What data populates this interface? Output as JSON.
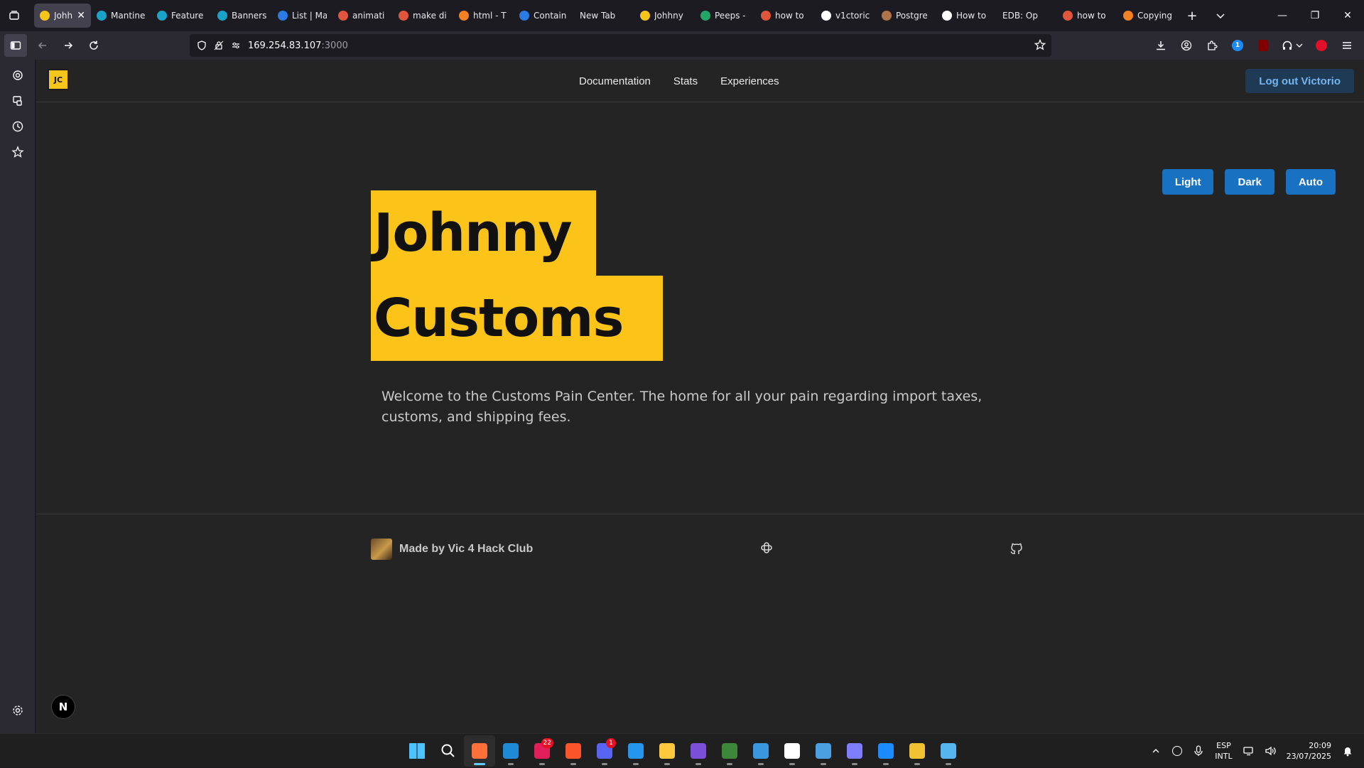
{
  "browser": {
    "tabs": [
      {
        "label": "Johh",
        "color": "#f6c51a",
        "active": true
      },
      {
        "label": "Mantine",
        "color": "#1aa3c9"
      },
      {
        "label": "Feature",
        "color": "#1aa3c9"
      },
      {
        "label": "Banners",
        "color": "#1aa3c9"
      },
      {
        "label": "List | Ma",
        "color": "#2a7be4"
      },
      {
        "label": "animati",
        "color": "#e0563c"
      },
      {
        "label": "make di",
        "color": "#e0563c"
      },
      {
        "label": "html - T",
        "color": "#f48024"
      },
      {
        "label": "Contain",
        "color": "#2a7be4"
      },
      {
        "label": "New Tab",
        "color": ""
      },
      {
        "label": "Johhny",
        "color": "#f6c51a"
      },
      {
        "label": "Peeps -",
        "color": "#23a566"
      },
      {
        "label": "how to",
        "color": "#e0563c"
      },
      {
        "label": "v1ctoric",
        "color": "#ffffff"
      },
      {
        "label": "Postgre",
        "color": "#b0744a"
      },
      {
        "label": "How to",
        "color": "#ffffff"
      },
      {
        "label": "EDB: Op",
        "color": ""
      },
      {
        "label": "how to",
        "color": "#e0563c"
      },
      {
        "label": "Copying",
        "color": "#f48024"
      }
    ],
    "url_host": "169.254.83.107",
    "url_port": ":3000"
  },
  "site": {
    "nav": [
      "Documentation",
      "Stats",
      "Experiences"
    ],
    "logout_label": "Log out Victorio",
    "theme_buttons": [
      "Light",
      "Dark",
      "Auto"
    ],
    "hero_line1": "Johnny",
    "hero_line2": "Customs",
    "welcome": "Welcome to the Customs Pain Center. The home for all your pain regarding import taxes, customs, and shipping fees.",
    "footer_credit": "Made by Vic 4 Hack Club",
    "next_badge": "N",
    "logo_text": "JC"
  },
  "taskbar": {
    "apps": [
      {
        "name": "windows-start",
        "color": "#4cc2ff"
      },
      {
        "name": "search",
        "color": ""
      },
      {
        "name": "firefox",
        "color": "#ff7139",
        "active": true
      },
      {
        "name": "vscode",
        "color": "#1e8ad6"
      },
      {
        "name": "slack",
        "color": "#e01e5a",
        "badge": "22"
      },
      {
        "name": "brave",
        "color": "#fb542b"
      },
      {
        "name": "discord",
        "color": "#5865f2",
        "badge": "1"
      },
      {
        "name": "docker",
        "color": "#2496ed"
      },
      {
        "name": "file-explorer",
        "color": "#ffc83d"
      },
      {
        "name": "datagrip",
        "color": "#7b4fd8"
      },
      {
        "name": "node",
        "color": "#3c873a"
      },
      {
        "name": "paint",
        "color": "#3a96dd"
      },
      {
        "name": "microsoft-store",
        "color": "#ffffff"
      },
      {
        "name": "maps-globe",
        "color": "#4aa0e0"
      },
      {
        "name": "obsidian-like",
        "color": "#7d7dff"
      },
      {
        "name": "1password",
        "color": "#1a8cff"
      },
      {
        "name": "git",
        "color": "#f1c232"
      },
      {
        "name": "notepad",
        "color": "#56b4f0"
      }
    ],
    "lang_top": "ESP",
    "lang_bottom": "INTL",
    "time": "20:09",
    "date": "23/07/2025"
  }
}
